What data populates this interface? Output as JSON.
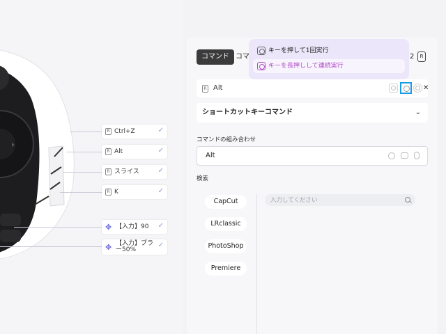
{
  "bindings": [
    {
      "label": "Ctrl+Z",
      "icon": "key-icon",
      "badge": "R"
    },
    {
      "label": "Alt",
      "icon": "key-icon",
      "badge": "R"
    },
    {
      "label": "スライス",
      "icon": "key-icon",
      "badge": "R"
    },
    {
      "label": "K",
      "icon": "key-icon",
      "badge": "R"
    },
    {
      "label": "【入力】90",
      "icon": "dpad-icon"
    },
    {
      "label": "【入力】ブラー50%",
      "icon": "dpad-icon"
    }
  ],
  "check_glyph": "✓",
  "panel": {
    "tab_active": "コマンド",
    "tab_next": "コマ",
    "page_num": "2",
    "page_badge": "R",
    "key_row": {
      "badge": "R",
      "label": "Alt",
      "remove": "✕"
    },
    "dropdown": {
      "label": "ショートカットキーコマンド",
      "chevron": "⌄"
    },
    "combo_title": "コマンドの組み合わせ",
    "combo_value": "Alt",
    "search_title": "検索",
    "apps": [
      "CapCut",
      "LRclassic",
      "PhotoShop",
      "Premiere"
    ],
    "search_placeholder": "入力してください"
  },
  "popup": {
    "press_label": "キーを押して1回実行",
    "hold_label": "キーを長押しして連続実行"
  },
  "colors": {
    "accent_blue": "#1a9be8",
    "popup_bg": "#ece6fa",
    "popup_active_text": "#b24cc8",
    "tab_active_bg": "#3b3b3b"
  }
}
